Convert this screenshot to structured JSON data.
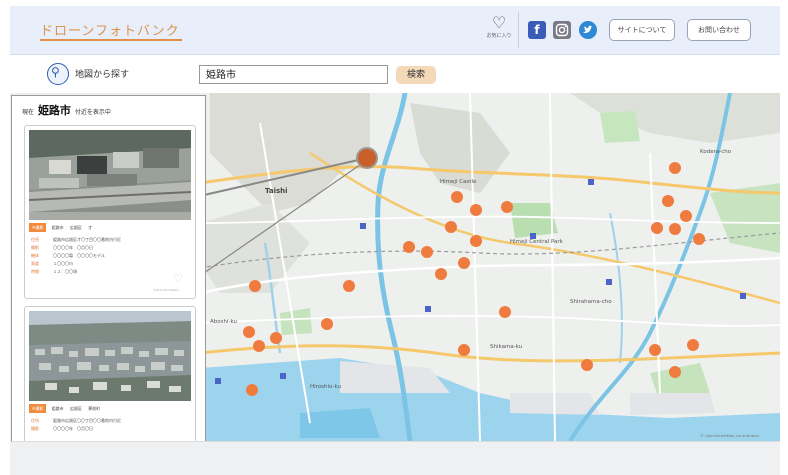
{
  "header": {
    "logo": "ドローンフォトバンク",
    "favorites_label": "お気に入り",
    "about_button": "サイトについて",
    "contact_button": "お問い合わせ",
    "colors": {
      "accent": "#e0904a",
      "header_bg": "#e8effa"
    }
  },
  "search": {
    "map_search_label": "地図から探す",
    "input_value": "姫路市",
    "button_label": "検索"
  },
  "panel": {
    "prefix": "現在",
    "city": "姫路市",
    "suffix": "付近を表示中",
    "cards": [
      {
        "tags": [
          "※撮影",
          "姫路市",
          "広畑区",
          "才"
        ],
        "rows": [
          {
            "k": "住所",
            "v": "姫路市広畑区才〇丁目〇〇番地内付近"
          },
          {
            "k": "撮影",
            "v": "〇〇〇〇年　〇月〇日"
          },
          {
            "k": "機体",
            "v": "〇〇〇〇製　〇〇〇〇モデル"
          },
          {
            "k": "高度",
            "v": "１〇〇〇ｍ"
          },
          {
            "k": "時間",
            "v": "１２：〇〇頃"
          }
        ],
        "credit": "©DroneFotoBank"
      },
      {
        "tags": [
          "※撮影",
          "姫路市",
          "広畑区",
          "夢前町"
        ],
        "rows": [
          {
            "k": "住所",
            "v": "姫路市広畑区〇〇丁目〇〇番地内付近"
          },
          {
            "k": "撮影",
            "v": "〇〇〇〇年　〇月〇日"
          }
        ]
      }
    ]
  },
  "map": {
    "labels": [
      "Taishi",
      "Aboshi-ku",
      "Himeji Castle",
      "Himeji Central Park",
      "Shirahama-cho",
      "Shikama-ku",
      "Hiroshio-ku",
      "Kodera-cho"
    ],
    "attribution": "© OpenStreetMap contributors"
  }
}
